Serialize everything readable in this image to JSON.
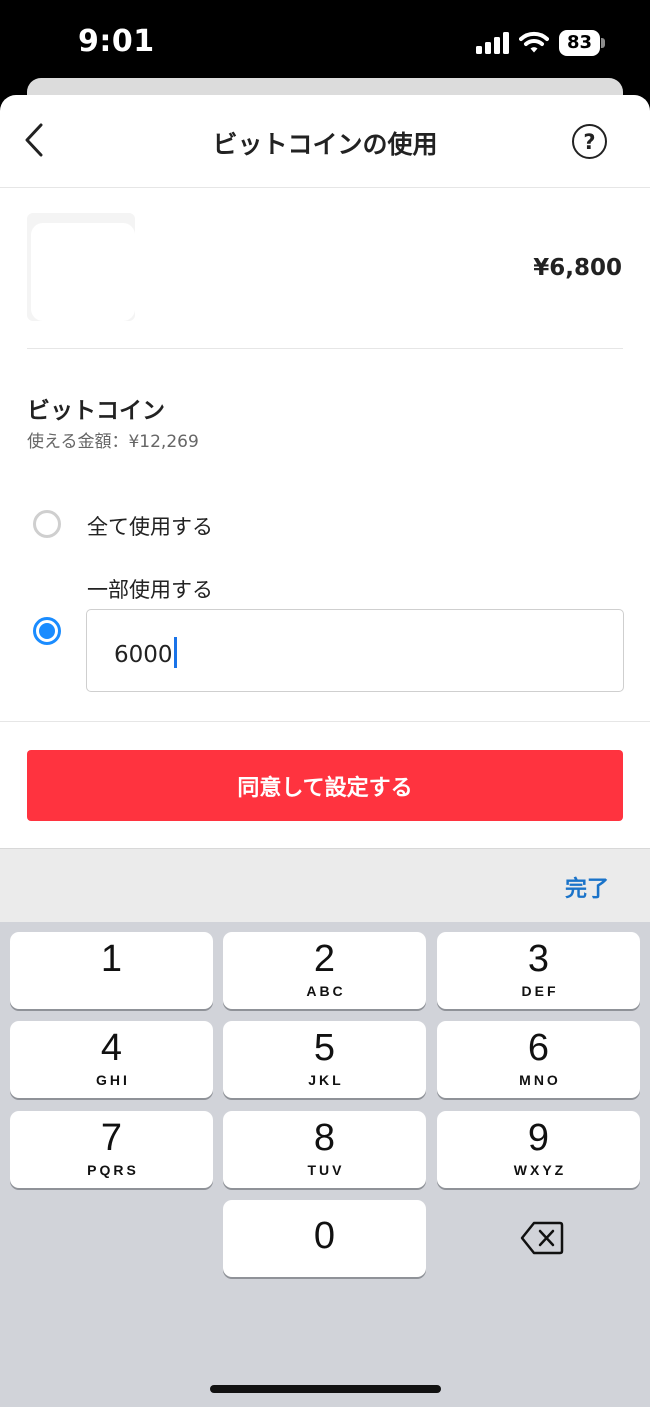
{
  "status_bar": {
    "time": "9:01",
    "battery": "83"
  },
  "nav": {
    "title": "ビットコインの使用",
    "help_label": "?"
  },
  "item": {
    "price": "¥6,800"
  },
  "bitcoin": {
    "title": "ビットコイン",
    "available": "使える金額：¥12,269",
    "options": [
      {
        "label": "全て使用する",
        "selected": false
      },
      {
        "label": "一部使用する",
        "selected": true
      }
    ],
    "amount_value": "6000"
  },
  "confirm_button": {
    "label": "同意して設定する"
  },
  "keyboard": {
    "done_label": "完了",
    "keys": [
      {
        "digit": "1",
        "letters": ""
      },
      {
        "digit": "2",
        "letters": "ABC"
      },
      {
        "digit": "3",
        "letters": "DEF"
      },
      {
        "digit": "4",
        "letters": "GHI"
      },
      {
        "digit": "5",
        "letters": "JKL"
      },
      {
        "digit": "6",
        "letters": "MNO"
      },
      {
        "digit": "7",
        "letters": "PQRS"
      },
      {
        "digit": "8",
        "letters": "TUV"
      },
      {
        "digit": "9",
        "letters": "WXYZ"
      },
      {
        "digit": "0",
        "letters": ""
      }
    ]
  },
  "colors": {
    "accent": "#ff333f",
    "radio": "#1a8cff",
    "link": "#1a73c9"
  },
  "icons": {
    "back": "chevron-left-icon",
    "help": "question-circle-icon",
    "delete": "backspace-icon",
    "signal": "signal-icon",
    "wifi": "wifi-icon",
    "battery": "battery-icon"
  }
}
